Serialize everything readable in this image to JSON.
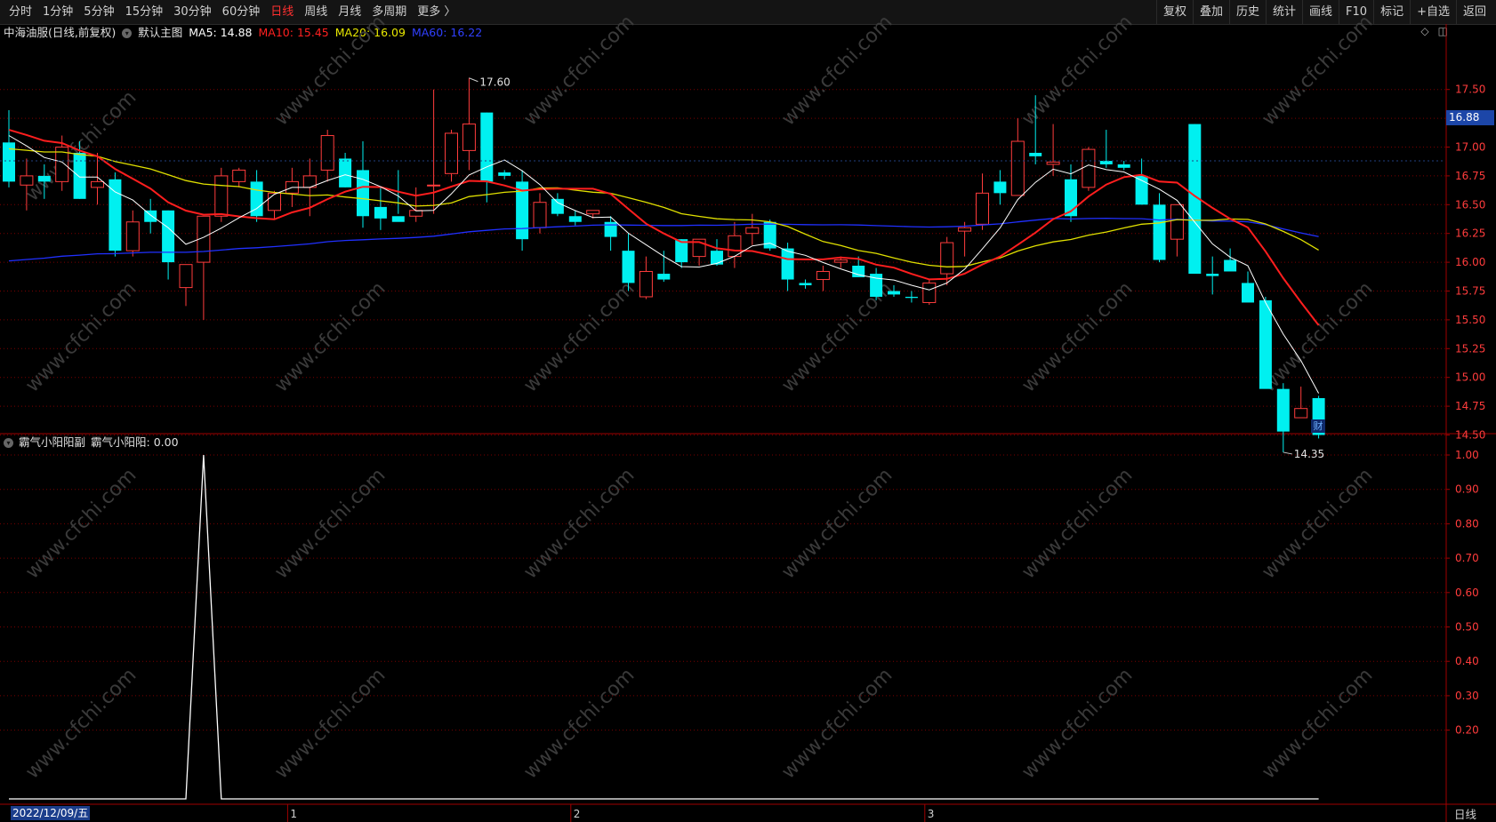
{
  "toolbar": {
    "left": [
      "分时",
      "1分钟",
      "5分钟",
      "15分钟",
      "30分钟",
      "60分钟",
      "日线",
      "周线",
      "月线",
      "多周期",
      "更多 〉"
    ],
    "active_index": 6,
    "right": [
      "复权",
      "叠加",
      "历史",
      "统计",
      "画线",
      "F10",
      "标记",
      "+自选",
      "返回"
    ]
  },
  "main_info": {
    "stock": "中海油服(日线,前复权)",
    "template": "默认主图",
    "ma5": "MA5: 14.88",
    "ma10": "MA10: 15.45",
    "ma20": "MA20: 16.09",
    "ma60": "MA60: 16.22"
  },
  "sub_info": {
    "name": "霸气小阳阳副",
    "value": "霸气小阳阳: 0.00"
  },
  "current_price": "16.88",
  "high_label": "17.60",
  "low_label": "14.35",
  "cai_badge": "财",
  "date_label": "2022/12/09/五",
  "period_label": "日线",
  "month_markers": [
    "1",
    "2",
    "3"
  ],
  "watermark": "www.cfchi.com",
  "colors": {
    "up": "#ff3c3c",
    "down": "#00f0f0",
    "ma5": "#ffffff",
    "ma10": "#ff1e1e",
    "ma20": "#e0e000",
    "ma60": "#2030ff",
    "grid": "#7a0000"
  },
  "chart_data": [
    {
      "type": "candlestick",
      "title": "中海油服(日线,前复权)",
      "y_ticks": [
        14.5,
        14.75,
        15.0,
        15.25,
        15.5,
        15.75,
        16.0,
        16.25,
        16.5,
        16.75,
        17.0,
        17.25,
        17.5
      ],
      "ylim": [
        14.3,
        17.8
      ],
      "x_markers": [
        "1",
        "2",
        "3"
      ],
      "series": [
        {
          "name": "K",
          "ohlc": [
            [
              17.04,
              17.32,
              16.65,
              16.7
            ],
            [
              16.67,
              16.9,
              16.45,
              16.75
            ],
            [
              16.75,
              16.85,
              16.55,
              16.7
            ],
            [
              16.7,
              17.1,
              16.62,
              17.0
            ],
            [
              16.95,
              17.05,
              16.55,
              16.55
            ],
            [
              16.65,
              16.95,
              16.5,
              16.7
            ],
            [
              16.72,
              16.78,
              16.05,
              16.1
            ],
            [
              16.1,
              16.45,
              16.05,
              16.35
            ],
            [
              16.45,
              16.55,
              16.25,
              16.35
            ],
            [
              16.45,
              16.45,
              15.85,
              16.0
            ],
            [
              15.78,
              15.98,
              15.62,
              15.98
            ],
            [
              16.0,
              16.4,
              15.5,
              16.4
            ],
            [
              16.4,
              16.82,
              16.35,
              16.75
            ],
            [
              16.7,
              16.82,
              16.65,
              16.8
            ],
            [
              16.7,
              16.8,
              16.35,
              16.4
            ],
            [
              16.45,
              16.62,
              16.38,
              16.6
            ],
            [
              16.6,
              16.82,
              16.48,
              16.7
            ],
            [
              16.65,
              16.9,
              16.4,
              16.75
            ],
            [
              16.8,
              17.15,
              16.7,
              17.1
            ],
            [
              16.9,
              16.95,
              16.65,
              16.65
            ],
            [
              16.8,
              17.05,
              16.3,
              16.4
            ],
            [
              16.48,
              16.65,
              16.28,
              16.38
            ],
            [
              16.4,
              16.8,
              16.42,
              16.35
            ],
            [
              16.4,
              16.65,
              16.35,
              16.45
            ],
            [
              16.67,
              17.5,
              16.42,
              16.67
            ],
            [
              16.77,
              17.15,
              16.7,
              17.12
            ],
            [
              16.97,
              17.6,
              16.8,
              17.2
            ],
            [
              17.3,
              17.3,
              16.52,
              16.7
            ],
            [
              16.78,
              16.8,
              16.72,
              16.75
            ],
            [
              16.7,
              16.8,
              16.1,
              16.2
            ],
            [
              16.3,
              16.6,
              16.25,
              16.52
            ],
            [
              16.55,
              16.6,
              16.4,
              16.42
            ],
            [
              16.4,
              16.45,
              16.32,
              16.35
            ],
            [
              16.42,
              16.45,
              16.38,
              16.45
            ],
            [
              16.35,
              16.4,
              16.1,
              16.22
            ],
            [
              16.1,
              16.25,
              15.75,
              15.82
            ],
            [
              15.7,
              16.05,
              15.68,
              15.92
            ],
            [
              15.9,
              16.1,
              15.83,
              15.85
            ],
            [
              16.2,
              16.2,
              15.95,
              16.0
            ],
            [
              16.05,
              16.2,
              15.97,
              16.2
            ],
            [
              16.1,
              16.2,
              15.97,
              15.98
            ],
            [
              16.05,
              16.35,
              15.95,
              16.23
            ],
            [
              16.25,
              16.42,
              16.15,
              16.3
            ],
            [
              16.35,
              16.37,
              16.1,
              16.12
            ],
            [
              16.12,
              16.17,
              15.75,
              15.85
            ],
            [
              15.82,
              15.85,
              15.77,
              15.8
            ],
            [
              15.85,
              15.97,
              15.75,
              15.92
            ],
            [
              16.0,
              16.05,
              15.95,
              16.02
            ],
            [
              15.97,
              16.05,
              15.9,
              15.87
            ],
            [
              15.9,
              15.95,
              15.67,
              15.7
            ],
            [
              15.75,
              15.8,
              15.7,
              15.72
            ],
            [
              15.7,
              15.75,
              15.65,
              15.69
            ],
            [
              15.65,
              15.85,
              15.63,
              15.82
            ],
            [
              15.9,
              16.22,
              15.8,
              16.17
            ],
            [
              16.27,
              16.35,
              16.05,
              16.3
            ],
            [
              16.33,
              16.77,
              16.28,
              16.6
            ],
            [
              16.7,
              16.8,
              16.5,
              16.6
            ],
            [
              16.58,
              17.25,
              16.58,
              17.05
            ],
            [
              16.95,
              17.45,
              16.85,
              16.92
            ],
            [
              16.85,
              17.2,
              16.75,
              16.87
            ],
            [
              16.72,
              16.85,
              16.35,
              16.4
            ],
            [
              16.65,
              17.0,
              16.62,
              16.98
            ],
            [
              16.88,
              17.15,
              16.82,
              16.85
            ],
            [
              16.85,
              16.88,
              16.8,
              16.82
            ],
            [
              16.75,
              16.9,
              16.5,
              16.5
            ],
            [
              16.5,
              16.6,
              16.0,
              16.02
            ],
            [
              16.2,
              16.5,
              16.05,
              16.5
            ],
            [
              17.2,
              17.2,
              15.9,
              15.9
            ],
            [
              15.9,
              16.05,
              15.72,
              15.88
            ],
            [
              16.02,
              16.12,
              15.95,
              15.92
            ],
            [
              15.82,
              15.92,
              15.7,
              15.65
            ],
            [
              15.67,
              15.7,
              14.95,
              14.9
            ],
            [
              14.9,
              14.95,
              14.35,
              14.53
            ],
            [
              14.65,
              14.92,
              14.65,
              14.73
            ],
            [
              14.82,
              14.84,
              14.47,
              14.5
            ]
          ]
        },
        {
          "name": "MA5"
        },
        {
          "name": "MA10"
        },
        {
          "name": "MA20"
        },
        {
          "name": "MA60"
        }
      ]
    },
    {
      "type": "line",
      "title": "霸气小阳阳副",
      "y_ticks": [
        0.2,
        0.3,
        0.4,
        0.5,
        0.6,
        0.7,
        0.8,
        0.9,
        1.0
      ],
      "ylim": [
        0.0,
        1.0
      ],
      "series": [
        {
          "name": "霸气小阳阳",
          "spike_index": 11,
          "spike_value": 1.0,
          "baseline": 0.0
        }
      ]
    }
  ]
}
